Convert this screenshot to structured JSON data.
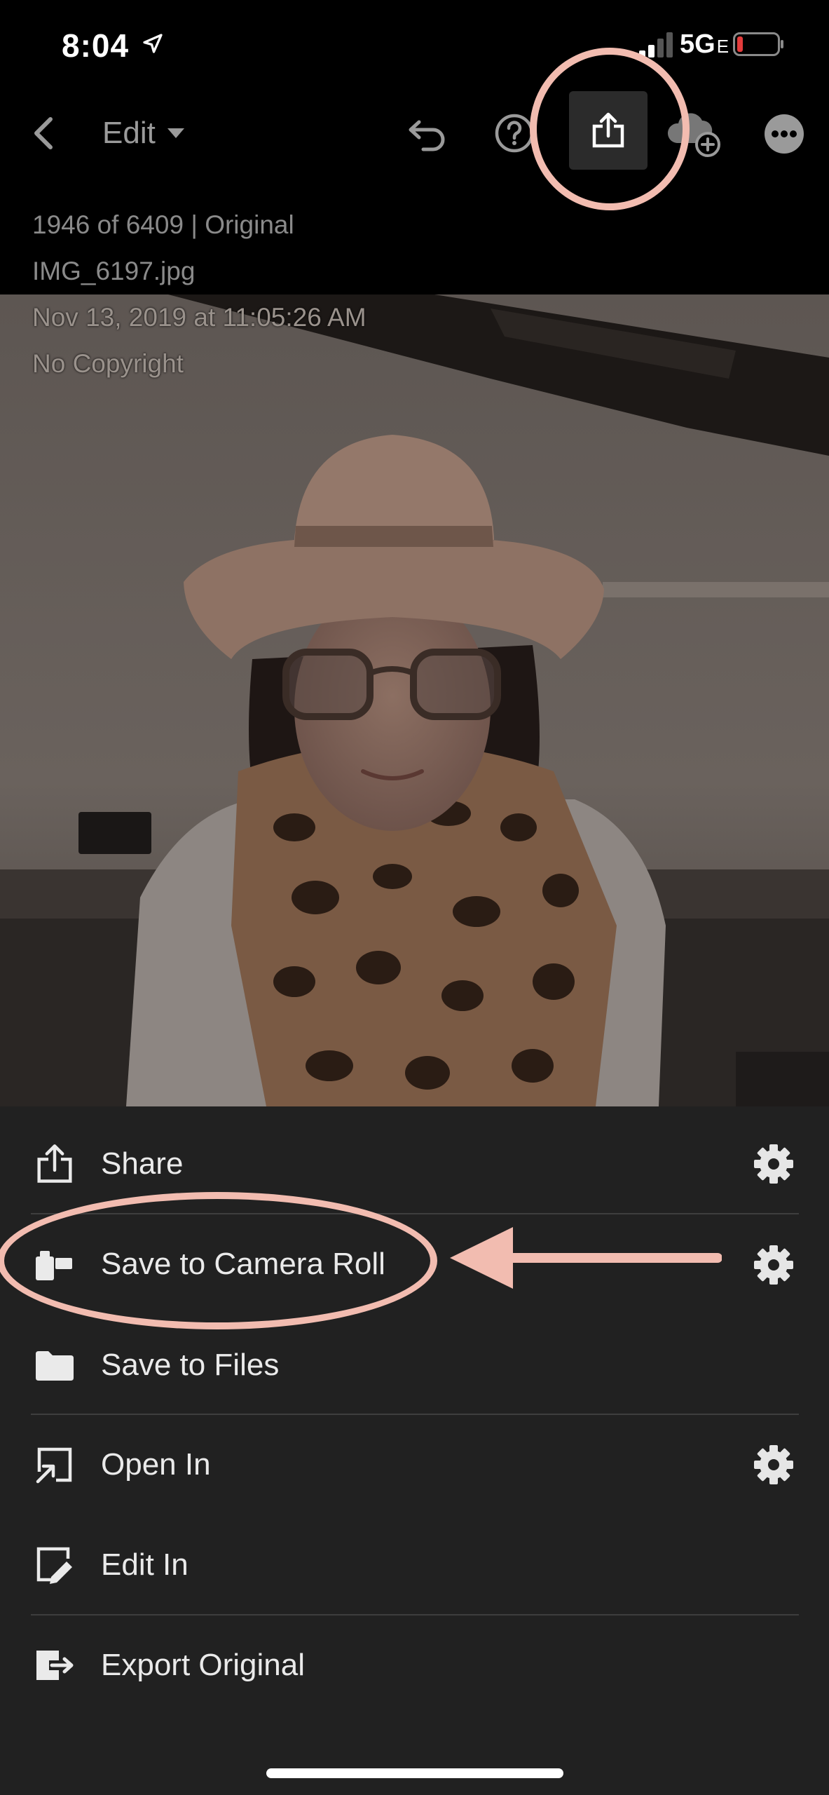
{
  "status_bar": {
    "time": "8:04",
    "network": "5G",
    "network_suffix": "E",
    "battery_color": "#e33b3b"
  },
  "toolbar": {
    "edit_label": "Edit",
    "icons": [
      "back-icon",
      "chevron-down-icon",
      "undo-icon",
      "help-icon",
      "share-icon",
      "cloud-add-icon",
      "more-icon"
    ]
  },
  "photo_info": {
    "counter": "1946 of 6409 | Original",
    "filename": "IMG_6197.jpg",
    "date": "Nov 13, 2019 at 11:05:26 AM",
    "copyright": "No Copyright"
  },
  "share_menu": {
    "items": [
      {
        "label": "Share",
        "icon": "share-icon",
        "has_settings": true
      },
      {
        "label": "Save to Camera Roll",
        "icon": "camera-roll-icon",
        "has_settings": true
      },
      {
        "label": "Save to Files",
        "icon": "folder-icon",
        "has_settings": false
      },
      {
        "label": "Open In",
        "icon": "open-in-icon",
        "has_settings": true
      },
      {
        "label": "Edit In",
        "icon": "edit-in-icon",
        "has_settings": false
      },
      {
        "label": "Export Original",
        "icon": "export-icon",
        "has_settings": false
      }
    ]
  },
  "annotations": {
    "highlight_color": "#f2bcb0"
  }
}
